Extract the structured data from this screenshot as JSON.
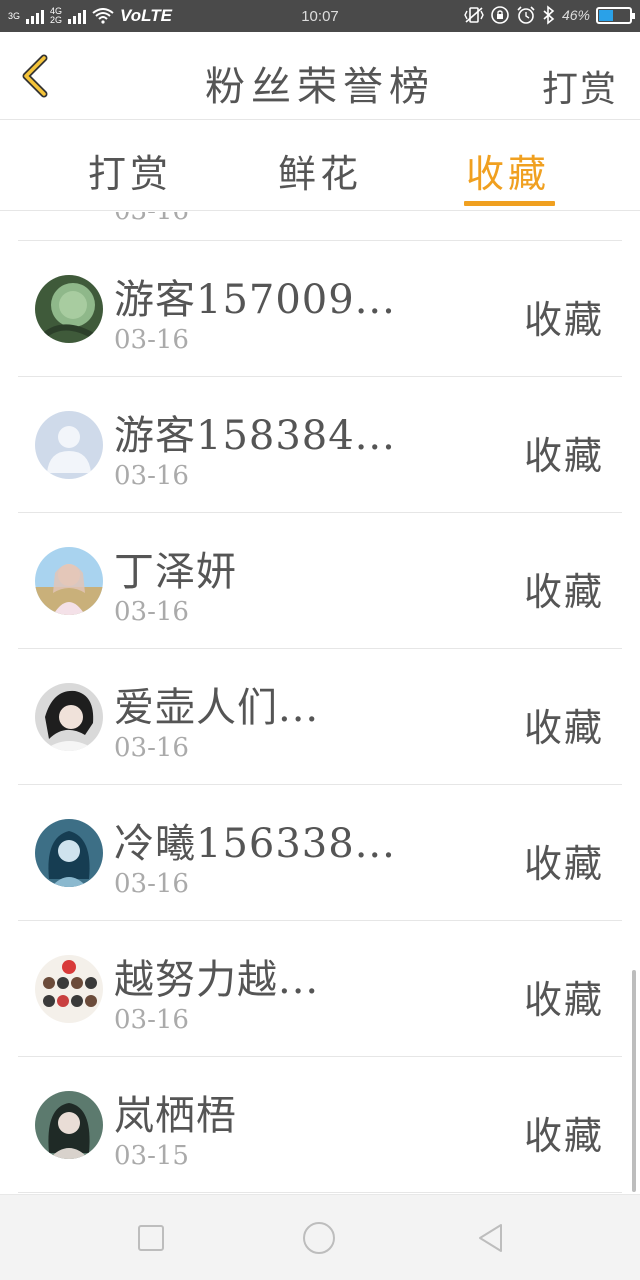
{
  "status_bar": {
    "net_top": "3G",
    "net_mid": "4G",
    "net_bottom": "2G",
    "volte": "VoLTE",
    "time": "10:07",
    "battery": "46%",
    "battery_level": 0.46
  },
  "header": {
    "title": "粉丝荣誉榜",
    "action": "打赏"
  },
  "tabs": [
    {
      "label": "打赏",
      "active": false
    },
    {
      "label": "鲜花",
      "active": false
    },
    {
      "label": "收藏",
      "active": true
    }
  ],
  "list": {
    "partial_date": "03-16",
    "items": [
      {
        "name": "游客157009...",
        "date": "03-16",
        "action": "收藏",
        "avatar": "lotus-leaf"
      },
      {
        "name": "游客158384...",
        "date": "03-16",
        "action": "收藏",
        "avatar": "default-user"
      },
      {
        "name": "丁泽妍",
        "date": "03-16",
        "action": "收藏",
        "avatar": "girl-outdoor"
      },
      {
        "name": "爱壶人们...",
        "date": "03-16",
        "action": "收藏",
        "avatar": "dark-hair-portrait"
      },
      {
        "name": "冷曦156338...",
        "date": "03-16",
        "action": "收藏",
        "avatar": "blue-anime-girl"
      },
      {
        "name": "越努力越...",
        "date": "03-16",
        "action": "收藏",
        "avatar": "cartoon-group"
      },
      {
        "name": "岚栖梧",
        "date": "03-15",
        "action": "收藏",
        "avatar": "girl-portrait"
      }
    ]
  },
  "colors": {
    "accent": "#f0a020",
    "text": "#555555",
    "subtext": "#aaaaaa",
    "divider": "#e6e6e6"
  }
}
